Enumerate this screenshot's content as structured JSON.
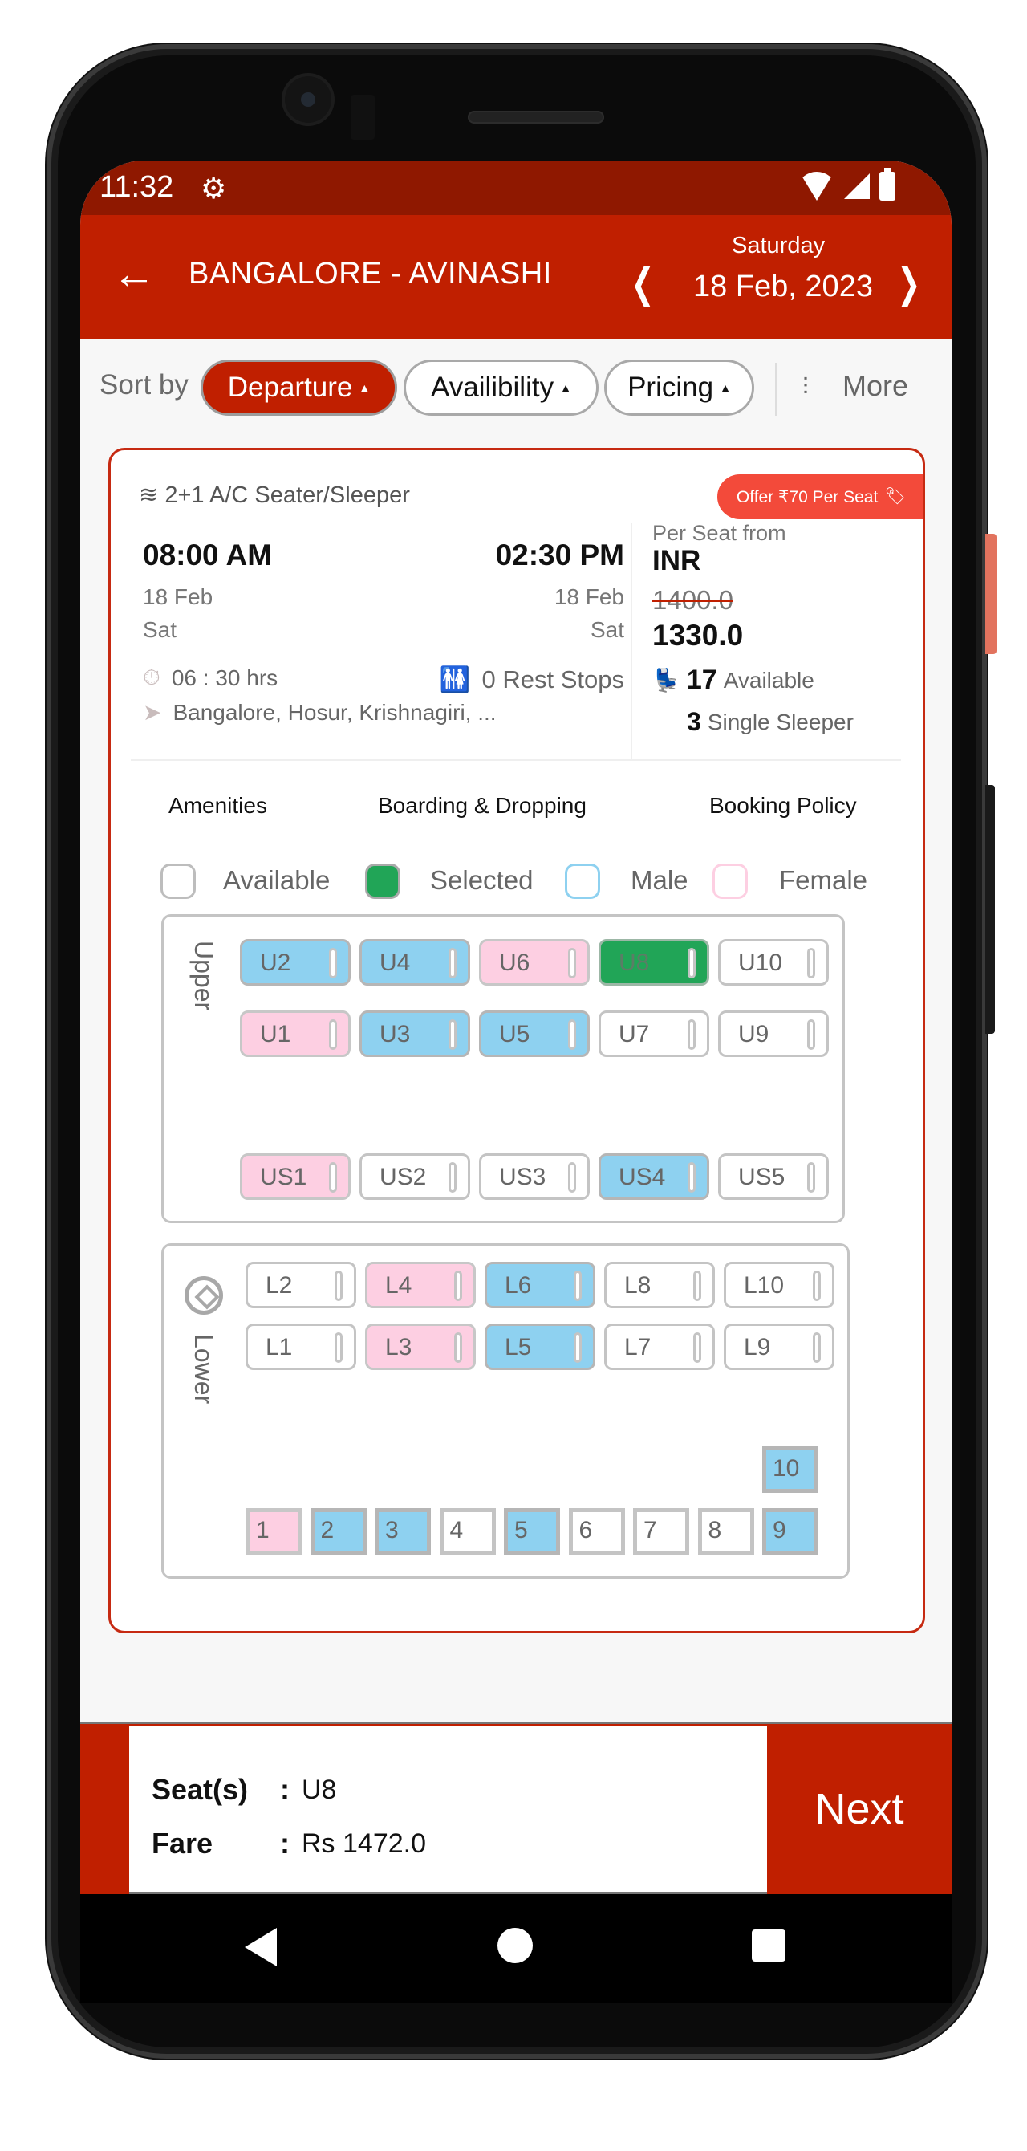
{
  "status_bar": {
    "time": "11:32"
  },
  "header": {
    "route": "BANGALORE - AVINASHI",
    "day": "Saturday",
    "date": "18 Feb, 2023"
  },
  "sort": {
    "label": "Sort by",
    "options": [
      {
        "label": "Departure",
        "active": true
      },
      {
        "label": "Availibility",
        "active": false
      },
      {
        "label": "Pricing",
        "active": false
      }
    ],
    "more_label": "More"
  },
  "bus": {
    "type": "2+1 A/C Seater/Sleeper",
    "offer": "Offer ₹70 Per Seat",
    "departure": {
      "time": "08:00 AM",
      "date": "18 Feb",
      "day": "Sat"
    },
    "arrival": {
      "time": "02:30 PM",
      "date": "18 Feb",
      "day": "Sat"
    },
    "duration": "06 : 30 hrs",
    "rest_stops": "0 Rest Stops",
    "via": "Bangalore, Hosur, Krishnagiri, ...",
    "price_label": "Per Seat from",
    "currency": "INR",
    "old_price": "1400.0",
    "price": "1330.0",
    "available_count": "17",
    "available_label": "Available",
    "single_sleeper_count": "3",
    "single_sleeper_label": "Single Sleeper"
  },
  "tabs": [
    "Amenities",
    "Boarding & Dropping",
    "Booking Policy"
  ],
  "legend": [
    {
      "label": "Available",
      "color": "#ffffff",
      "border": "#bdbdbd"
    },
    {
      "label": "Selected",
      "color": "#21a557",
      "border": "#a9a9a9"
    },
    {
      "label": "Male",
      "color": "#ffffff",
      "border": "#8ed1f0"
    },
    {
      "label": "Female",
      "color": "#ffffff",
      "border": "#fdcfe2"
    }
  ],
  "colors": {
    "primary": "#c01f00",
    "status_bar": "#8f1800",
    "male": "#8ed1f0",
    "female": "#fdcfe2",
    "selected": "#21a557",
    "offer": "#f34a3a"
  },
  "upper_deck": {
    "label": "Upper",
    "rows": [
      [
        {
          "id": "U2",
          "status": "male"
        },
        {
          "id": "U4",
          "status": "male"
        },
        {
          "id": "U6",
          "status": "female"
        },
        {
          "id": "U8",
          "status": "selected"
        },
        {
          "id": "U10",
          "status": "available"
        }
      ],
      [
        {
          "id": "U1",
          "status": "female"
        },
        {
          "id": "U3",
          "status": "male"
        },
        {
          "id": "U5",
          "status": "male"
        },
        {
          "id": "U7",
          "status": "available"
        },
        {
          "id": "U9",
          "status": "available"
        }
      ],
      [
        {
          "id": "US1",
          "status": "female"
        },
        {
          "id": "US2",
          "status": "available"
        },
        {
          "id": "US3",
          "status": "available"
        },
        {
          "id": "US4",
          "status": "male"
        },
        {
          "id": "US5",
          "status": "available"
        }
      ]
    ]
  },
  "lower_deck": {
    "label": "Lower",
    "rows": [
      [
        {
          "id": "L2",
          "status": "available"
        },
        {
          "id": "L4",
          "status": "female"
        },
        {
          "id": "L6",
          "status": "male"
        },
        {
          "id": "L8",
          "status": "available"
        },
        {
          "id": "L10",
          "status": "available"
        }
      ],
      [
        {
          "id": "L1",
          "status": "available"
        },
        {
          "id": "L3",
          "status": "female"
        },
        {
          "id": "L5",
          "status": "male"
        },
        {
          "id": "L7",
          "status": "available"
        },
        {
          "id": "L9",
          "status": "available"
        }
      ]
    ],
    "seat_extra": {
      "id": "10",
      "status": "male"
    },
    "seats": [
      {
        "id": "1",
        "status": "female"
      },
      {
        "id": "2",
        "status": "male"
      },
      {
        "id": "3",
        "status": "male"
      },
      {
        "id": "4",
        "status": "available"
      },
      {
        "id": "5",
        "status": "male"
      },
      {
        "id": "6",
        "status": "available"
      },
      {
        "id": "7",
        "status": "available"
      },
      {
        "id": "8",
        "status": "available"
      },
      {
        "id": "9",
        "status": "male"
      }
    ]
  },
  "summary": {
    "seats_label": "Seat(s)",
    "seats_value": "U8",
    "fare_label": "Fare",
    "fare_value": "Rs 1472.0",
    "next_label": "Next"
  }
}
